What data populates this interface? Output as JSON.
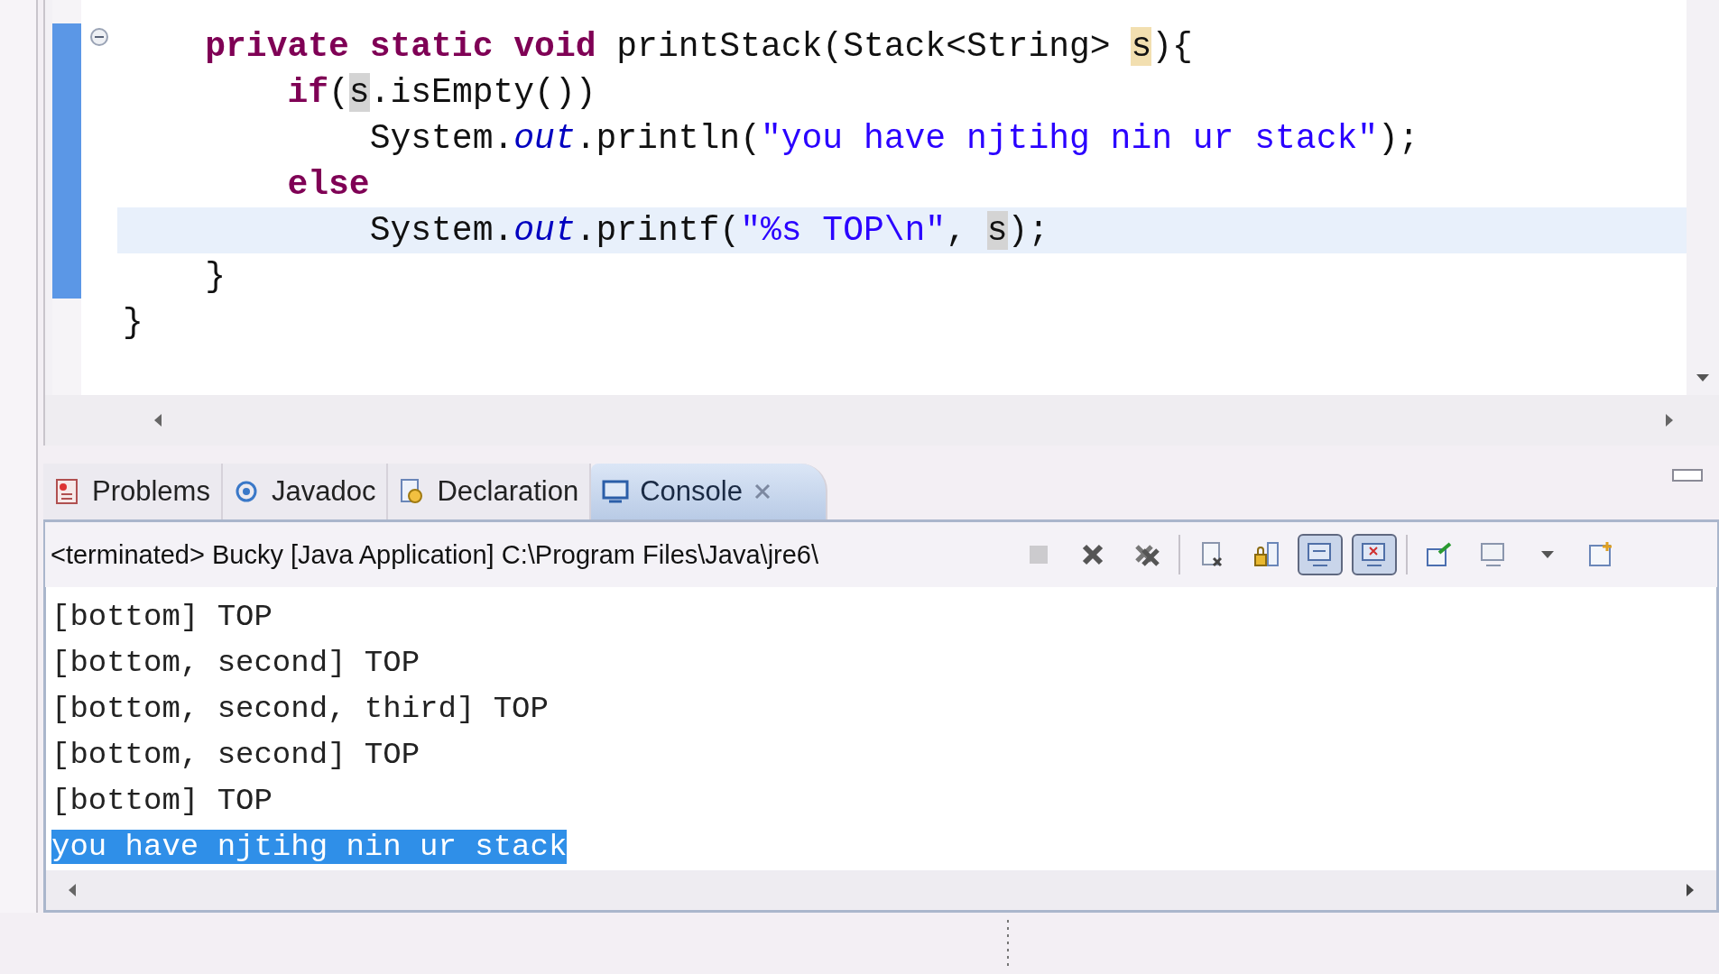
{
  "editor": {
    "lines": [
      {
        "current": false,
        "fold": true,
        "tokens": [
          {
            "kind": "keyword",
            "text": "    private static void"
          },
          {
            "kind": "plain",
            "text": " printStack(Stack<String> "
          },
          {
            "kind": "occurrence_write",
            "text": "s"
          },
          {
            "kind": "plain",
            "text": "){"
          }
        ]
      },
      {
        "current": false,
        "fold": false,
        "tokens": [
          {
            "kind": "keyword",
            "text": "        if"
          },
          {
            "kind": "plain",
            "text": "("
          },
          {
            "kind": "occurrence",
            "text": "s"
          },
          {
            "kind": "plain",
            "text": ".isEmpty())"
          }
        ]
      },
      {
        "current": false,
        "fold": false,
        "tokens": [
          {
            "kind": "plain",
            "text": "            System."
          },
          {
            "kind": "field",
            "text": "out"
          },
          {
            "kind": "plain",
            "text": ".println("
          },
          {
            "kind": "string",
            "text": "\"you have njtihg nin ur stack\""
          },
          {
            "kind": "plain",
            "text": ");"
          }
        ]
      },
      {
        "current": false,
        "fold": false,
        "tokens": [
          {
            "kind": "keyword",
            "text": "        else"
          }
        ]
      },
      {
        "current": true,
        "fold": false,
        "tokens": [
          {
            "kind": "plain",
            "text": "            System."
          },
          {
            "kind": "field",
            "text": "out"
          },
          {
            "kind": "plain",
            "text": ".printf("
          },
          {
            "kind": "string",
            "text": "\"%s TOP\\n\""
          },
          {
            "kind": "plain",
            "text": ", "
          },
          {
            "kind": "occurrence",
            "text": "s"
          },
          {
            "kind": "plain",
            "text": ");"
          }
        ]
      },
      {
        "current": false,
        "fold": false,
        "tokens": [
          {
            "kind": "plain",
            "text": "    }"
          }
        ]
      },
      {
        "current": false,
        "fold": false,
        "tokens": [
          {
            "kind": "plain",
            "text": "}"
          }
        ]
      }
    ]
  },
  "tabs": [
    {
      "kind": "problems",
      "label": "Problems",
      "selected": false
    },
    {
      "kind": "javadoc",
      "label": "Javadoc",
      "selected": false
    },
    {
      "kind": "declaration",
      "label": "Declaration",
      "selected": false
    },
    {
      "kind": "console",
      "label": "Console",
      "selected": true
    }
  ],
  "console": {
    "description": "<terminated> Bucky [Java Application] C:\\Program Files\\Java\\jre6\\",
    "toolbar": [
      {
        "kind": "terminate",
        "disabled": true,
        "pressed": false
      },
      {
        "kind": "remove",
        "disabled": false,
        "pressed": false
      },
      {
        "kind": "remove_all",
        "disabled": false,
        "pressed": false
      },
      {
        "kind": "separator"
      },
      {
        "kind": "clear",
        "disabled": false,
        "pressed": false
      },
      {
        "kind": "scroll_lock",
        "disabled": false,
        "pressed": false
      },
      {
        "kind": "show_stdout",
        "disabled": false,
        "pressed": true
      },
      {
        "kind": "show_stderr",
        "disabled": false,
        "pressed": true
      },
      {
        "kind": "separator"
      },
      {
        "kind": "pin",
        "disabled": false,
        "pressed": false
      },
      {
        "kind": "display",
        "disabled": false,
        "pressed": false
      },
      {
        "kind": "dropdown",
        "disabled": false,
        "pressed": false
      },
      {
        "kind": "open",
        "disabled": false,
        "pressed": false
      }
    ],
    "lines": [
      {
        "text": "[bottom] TOP",
        "selected": false
      },
      {
        "text": "[bottom, second] TOP",
        "selected": false
      },
      {
        "text": "[bottom, second, third] TOP",
        "selected": false
      },
      {
        "text": "[bottom, second] TOP",
        "selected": false
      },
      {
        "text": "[bottom] TOP",
        "selected": false
      },
      {
        "text": "you have njtihg nin ur stack",
        "selected": true
      }
    ]
  }
}
